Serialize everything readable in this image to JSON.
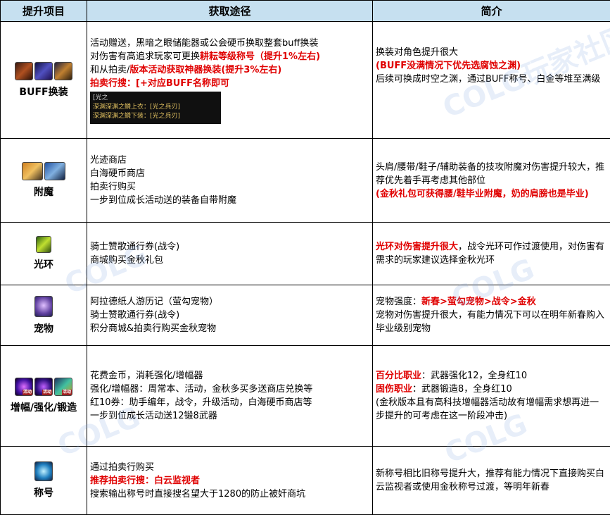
{
  "header": {
    "col1": "提升项目",
    "col2": "获取途径",
    "col3": "简介"
  },
  "rows": [
    {
      "label": "BUFF换装",
      "icons": [
        "buff-helmet-icon",
        "buff-armor-icon",
        "buff-weapon-icon"
      ],
      "source": {
        "l1": "活动赠送，黑暗之眼储能器或公会硬币换取整套buff换装",
        "l2a": "对伤害有高追求玩家可更换",
        "l2b": "耕耘等级称号（提升1%左右)",
        "l3a": "和从拍卖/",
        "l3b": "版本活动获取神器换装(提升3%左右)",
        "l4": "拍卖行搜：[+对应BUFF名称即可",
        "auction": [
          "[光之",
          "深渊深渊之鳞上衣：[光之兵刃]",
          "深渊深渊之鳞下装：[光之兵刃]"
        ]
      },
      "intro": {
        "l1": "换装对角色提升很大",
        "l2": "(BUFF没满情况下优先选腐蚀之渊)",
        "l3": "后续可换成时空之渊，通过BUFF称号、白金等堆至满级"
      }
    },
    {
      "label": "附魔",
      "icons": [
        "enchant-card-gold-icon",
        "enchant-card-blue-icon"
      ],
      "source": {
        "l1": "光迹商店",
        "l2": "白海硬币商店",
        "l3": "拍卖行购买",
        "l4": "一步到位成长活动送的装备自带附魔"
      },
      "intro": {
        "l1": "头肩/腰带/鞋子/辅助装备的技攻附魔对伤害提升较大，推荐优先着手再考虑其他部位",
        "l2": "(金秋礼包可获得腰/鞋毕业附魔，奶的肩膀也是毕业)"
      }
    },
    {
      "label": "光环",
      "icons": [
        "aura-icon"
      ],
      "source": {
        "l1": "骑士赞歌通行券(战令)",
        "l2": "商城购买金秋礼包"
      },
      "intro": {
        "l1a": "光环对伤害提升很大",
        "l1b": "，战令光环可作过渡使用，对伤害有需求的玩家建议选择金秋光环"
      }
    },
    {
      "label": "宠物",
      "icons": [
        "pet-icon"
      ],
      "source": {
        "l1": "阿拉德纸人游历记（萤勾宠物）",
        "l2": "骑士赞歌通行券(战令)",
        "l3": "积分商城&拍卖行购买金秋宠物"
      },
      "intro": {
        "l1a": "宠物强度：",
        "l1b": "新春>萤勾宠物>战令>金秋",
        "l2": "宠物对伤害提升很大，有能力情况下可以在明年新春购入毕业级别宠物"
      }
    },
    {
      "label": "增幅/强化/锻造",
      "icons": [
        "amplify-orb-icon",
        "reinforce-orb-icon",
        "forge-icon"
      ],
      "icon_tag": "活动",
      "source": {
        "l1": "花费金币，消耗强化/增幅器",
        "l2": "强化/增幅器：周常本、活动，金秋多买多送商店兑换等",
        "l3": "红10券：助手编年，战令，升级活动，白海硬币商店等",
        "l4": "一步到位成长活动送12锻8武器"
      },
      "intro": {
        "l1a": "百分比职业",
        "l1b": "：武器强化12，全身红10",
        "l2a": "固伤职业",
        "l2b": "：武器锻造8，全身红10",
        "l3": "(金秋版本且有高科技增幅器活动故有增幅需求想再进一步提升的可考虑在这一阶段冲击)"
      }
    },
    {
      "label": "称号",
      "icons": [
        "title-icon"
      ],
      "source": {
        "l1": "通过拍卖行购买",
        "l2": "推荐拍卖行搜：白云监视者",
        "l3": "搜索输出称号时直接搜名望大于1280的防止被奸商坑"
      },
      "intro": {
        "l1": "新称号相比旧称号提升大，推荐有能力情况下直接购买白云监视者或使用金秋称号过渡，等明年新春"
      }
    }
  ],
  "watermark": [
    "COLG",
    "COLG",
    "COLG",
    "COLG",
    "COLG玩家社区"
  ]
}
